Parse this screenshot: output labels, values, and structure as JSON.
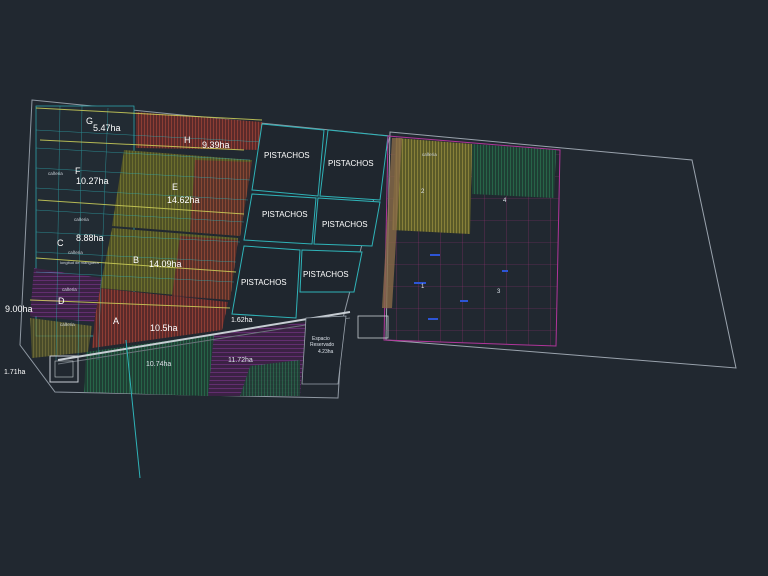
{
  "colors": {
    "background": "#212830",
    "boundary": "#9aa3ad",
    "cyan_line": "#2fb3b8",
    "magenta_line": "#b0359a",
    "olive_fill": "#6b6a2a",
    "red_hatch": "#b8463a",
    "green_hatch": "#2e8b57",
    "purple_hatch": "#7a2f8c",
    "yellow_line": "#cfd25a",
    "blue_marks": "#2d55d6"
  },
  "blocks": {
    "G": {
      "letter": "G",
      "area": "5.47ha"
    },
    "H": {
      "letter": "H",
      "area": "9.39ha"
    },
    "F": {
      "letter": "F",
      "area": "10.27ha"
    },
    "E": {
      "letter": "E",
      "area": "14.62ha"
    },
    "C": {
      "letter": "C",
      "area": "8.88ha"
    },
    "B": {
      "letter": "B",
      "area": "14.09ha"
    },
    "D": {
      "letter": "D",
      "area": "9.00ha"
    },
    "A": {
      "letter": "A",
      "area": "10.5ha"
    }
  },
  "parcels": {
    "small_middle": "1.62ha",
    "bottom_left": "1.71ha",
    "green_lower": "10.74ha",
    "purple_lower": "11.72ha"
  },
  "pistachos": [
    "PISTACHOS",
    "PISTACHOS",
    "PISTACHOS",
    "PISTACHOS",
    "PISTACHOS",
    "PISTACHOS"
  ],
  "reserved": {
    "line1": "Espacio",
    "line2": "Reservado",
    "area": "4.23ha"
  },
  "small_labels": {
    "cañeria_1": "cañeria",
    "cañeria_2": "cañeria",
    "cañeria_3": "cañeria",
    "cañeria_4": "cañeria",
    "cañeria_5": "cañeria",
    "cañeria_right": "cañeria",
    "longitud": "longitud de manguera"
  },
  "sectors": {
    "s1": "1",
    "s2": "2",
    "s3": "3",
    "s4": "4"
  }
}
